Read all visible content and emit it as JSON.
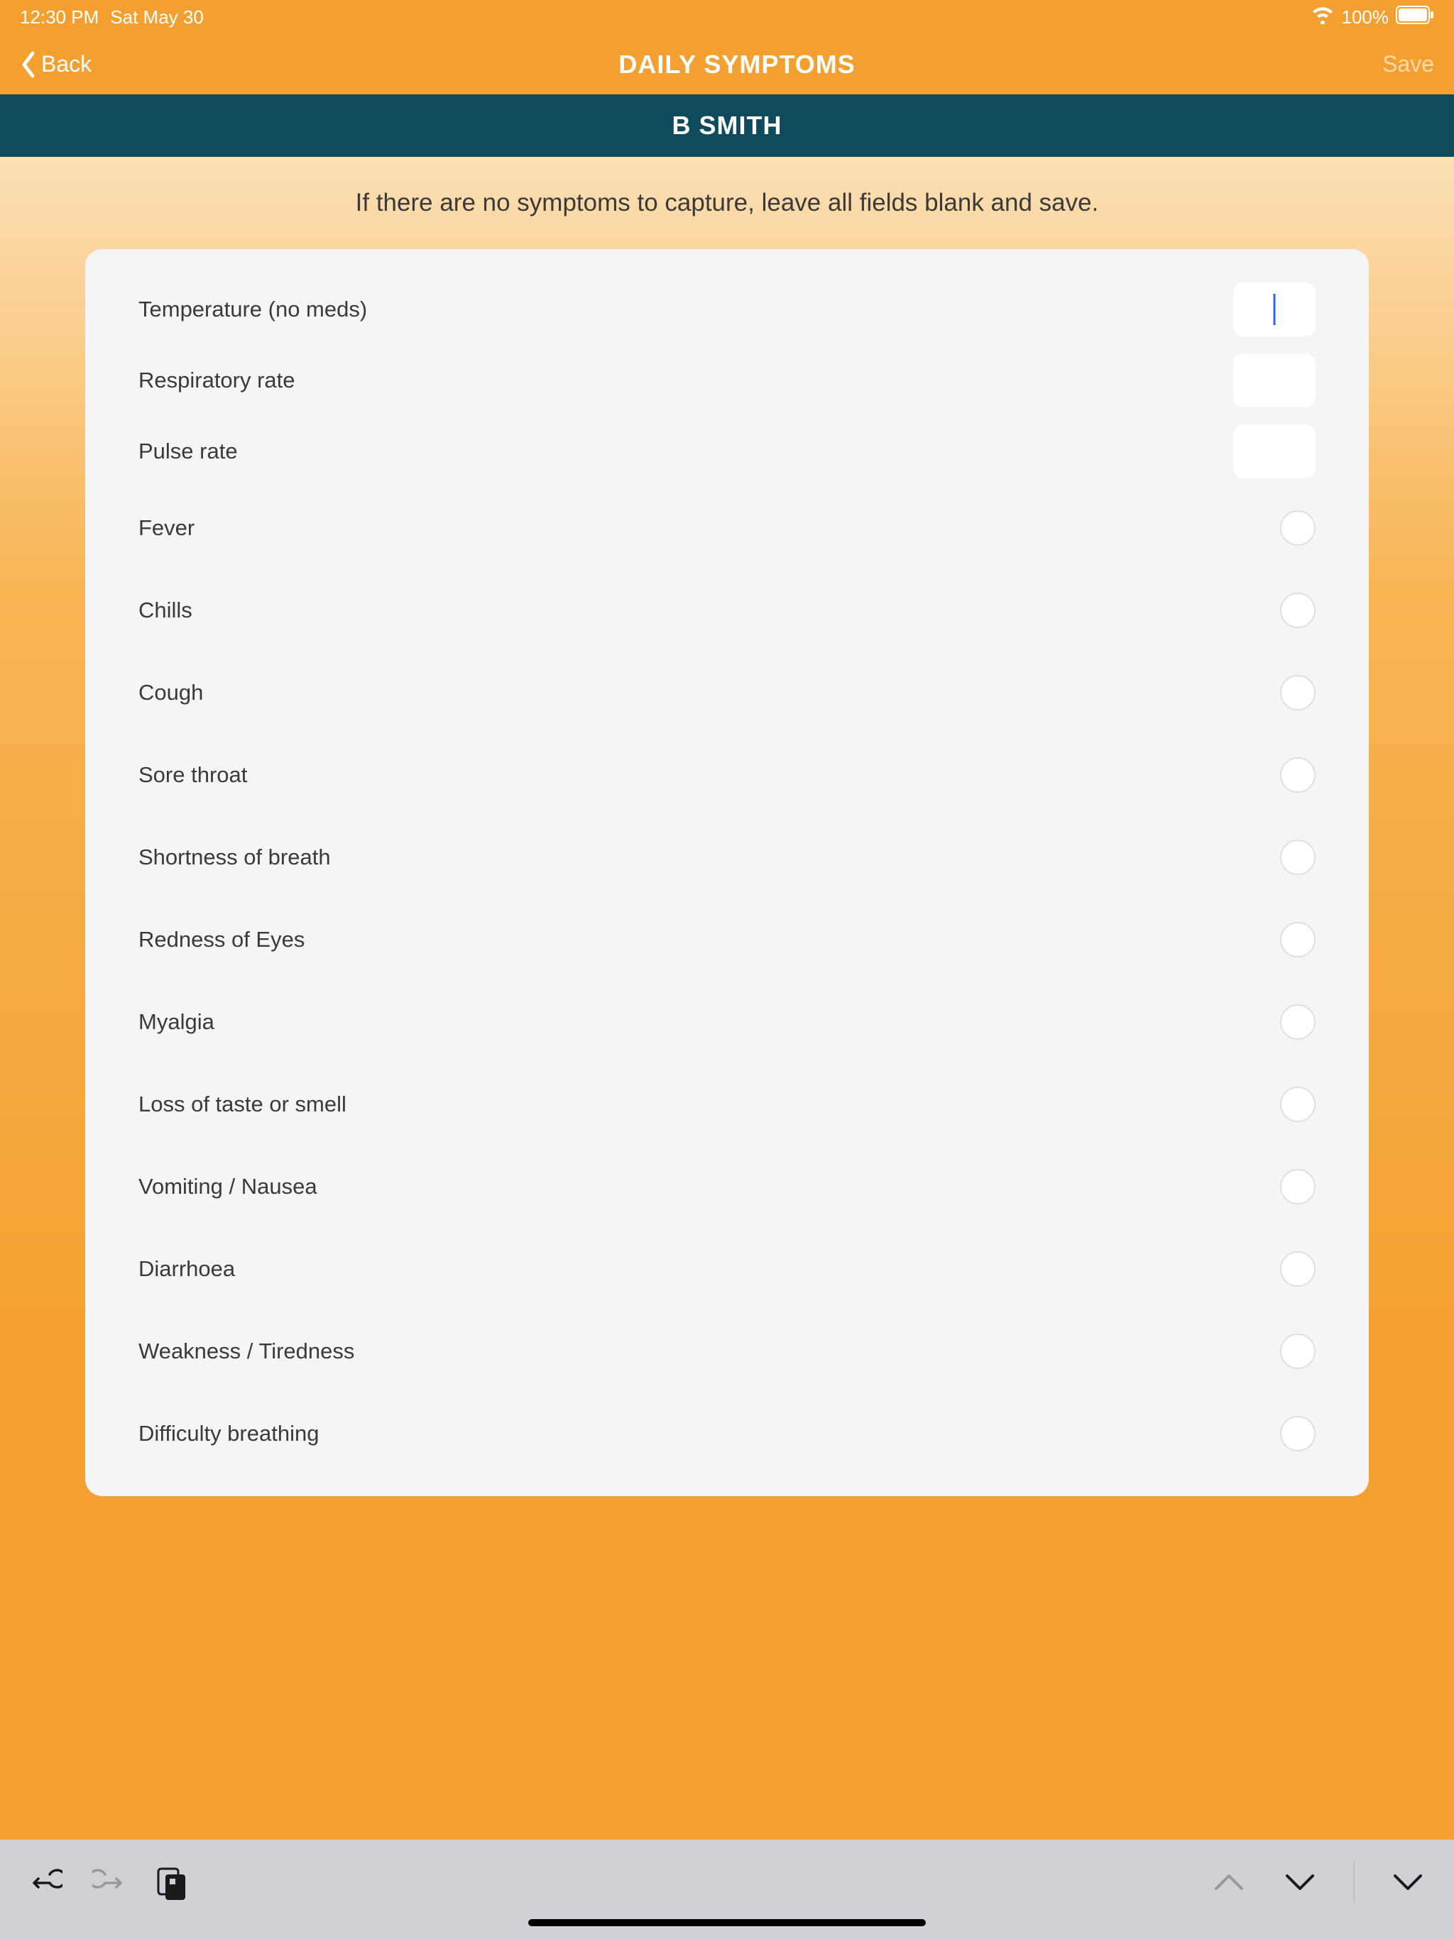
{
  "status": {
    "time": "12:30 PM",
    "date": "Sat May 30",
    "battery": "100%"
  },
  "nav": {
    "back_label": "Back",
    "title": "DAILY SYMPTOMS",
    "save_label": "Save"
  },
  "patient_name": "B SMITH",
  "instruction_text": "If there are no symptoms to capture, leave all fields blank and save.",
  "numeric_fields": [
    {
      "label": "Temperature (no meds)",
      "value": "",
      "has_cursor": true
    },
    {
      "label": "Respiratory rate",
      "value": "",
      "has_cursor": false
    },
    {
      "label": "Pulse rate",
      "value": "",
      "has_cursor": false
    }
  ],
  "symptom_fields": [
    {
      "label": "Fever"
    },
    {
      "label": "Chills"
    },
    {
      "label": "Cough"
    },
    {
      "label": "Sore throat"
    },
    {
      "label": "Shortness of breath"
    },
    {
      "label": "Redness of Eyes"
    },
    {
      "label": "Myalgia"
    },
    {
      "label": "Loss of taste or smell"
    },
    {
      "label": "Vomiting / Nausea"
    },
    {
      "label": "Diarrhoea"
    },
    {
      "label": "Weakness / Tiredness"
    },
    {
      "label": "Difficulty breathing"
    }
  ]
}
